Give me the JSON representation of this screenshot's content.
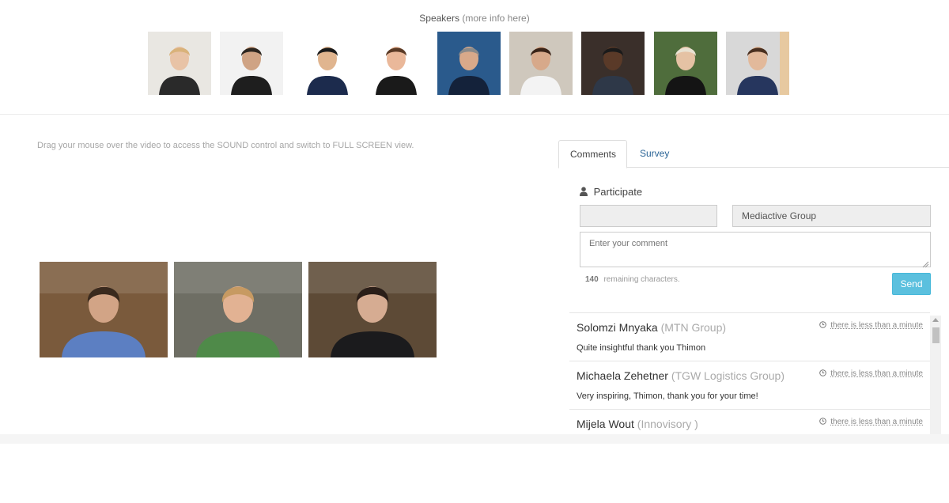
{
  "speakers": {
    "title": "Speakers",
    "more_info": "(more info here)",
    "portraits": [
      {
        "name": "speaker-1",
        "bg": "#e9e7e2",
        "skin": "#e8c3a6",
        "hair": "#d9b27a",
        "suit": "#2a2a2a"
      },
      {
        "name": "speaker-2",
        "bg": "#f2f2f2",
        "skin": "#cfa384",
        "hair": "#2d2620",
        "suit": "#1e1e1e"
      },
      {
        "name": "speaker-3",
        "bg": "#ffffff",
        "skin": "#e0b58f",
        "hair": "#1b1b1b",
        "suit": "#1c2b4d"
      },
      {
        "name": "speaker-4",
        "bg": "#ffffff",
        "skin": "#eab89a",
        "hair": "#5a3a26",
        "suit": "#1a1a1a"
      },
      {
        "name": "speaker-5",
        "bg": "#2a5a8c",
        "skin": "#d8a98a",
        "hair": "#8a8a8a",
        "suit": "#14223a"
      },
      {
        "name": "speaker-6",
        "bg": "#cfc8bd",
        "skin": "#d7a98a",
        "hair": "#3a2418",
        "suit": "#f3f3f3"
      },
      {
        "name": "speaker-7",
        "bg": "#3a2f2a",
        "skin": "#5a3a28",
        "hair": "#1a1a1a",
        "suit": "#2e3848"
      },
      {
        "name": "speaker-8",
        "bg": "#4f6d3c",
        "skin": "#e5c2a4",
        "hair": "#e9e2d2",
        "suit": "#141414"
      },
      {
        "name": "speaker-9",
        "bg": "#d8d8d8",
        "skin": "#e2b99b",
        "hair": "#4a3020",
        "suit": "#26365e"
      },
      {
        "name": "speaker-10",
        "bg": "#e7c9a0",
        "skin": "#e7c9a0",
        "hair": "#c9a278",
        "suit": "#d6b48a"
      }
    ]
  },
  "video": {
    "hint": "Drag your mouse over the video to access the SOUND control and switch to FULL SCREEN view.",
    "participants": [
      {
        "name": "video-tile-1",
        "bg": "#7a5a3c",
        "skin": "#d2a486",
        "hair": "#3a2a1e",
        "shirt": "#5c7fc2"
      },
      {
        "name": "video-tile-2",
        "bg": "#6e6e64",
        "skin": "#e2b293",
        "hair": "#c79a62",
        "shirt": "#4f8a49"
      },
      {
        "name": "video-tile-3",
        "bg": "#5d4a36",
        "skin": "#d6ac92",
        "hair": "#2a1e18",
        "shirt": "#1b1b1d"
      }
    ]
  },
  "panel": {
    "tabs": [
      {
        "label": "Comments",
        "active": true
      },
      {
        "label": "Survey",
        "active": false
      }
    ],
    "participate_label": "Participate",
    "name_value": "",
    "company_value": "Mediactive Group",
    "comment_placeholder": "Enter your comment",
    "remaining_count": "140",
    "remaining_label": "remaining characters.",
    "send_label": "Send"
  },
  "comments": [
    {
      "author": "Solomzi Mnyaka",
      "company": "(MTN Group)",
      "time": "there is less than a minute",
      "body": "Quite insightful thank you Thimon"
    },
    {
      "author": "Michaela Zehetner",
      "company": "(TGW Logistics Group)",
      "time": "there is less than a minute",
      "body": "Very inspiring, Thimon, thank you for your time!"
    },
    {
      "author": "Mijela Wout",
      "company": "(Innovisory )",
      "time": "there is less than a minute",
      "body": ""
    }
  ],
  "colors": {
    "accent": "#5bc0de",
    "link": "#2a6496"
  }
}
